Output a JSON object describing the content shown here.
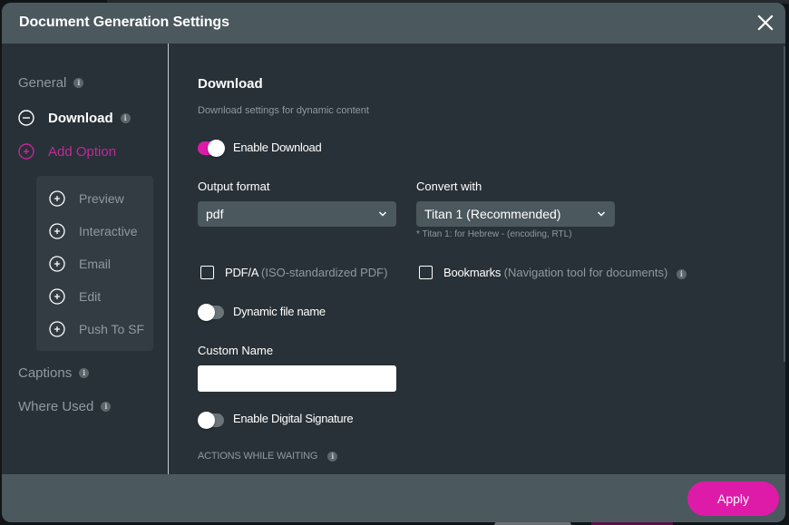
{
  "dialog": {
    "title": "Document Generation Settings",
    "close_icon": "close-icon"
  },
  "sidebar": {
    "items": [
      {
        "label": "General",
        "info": "i",
        "state": "default"
      },
      {
        "label": "Download",
        "info": "i",
        "state": "active",
        "icon": "minus-circle-icon"
      },
      {
        "label": "Add Option",
        "state": "add",
        "icon": "plus-circle-icon"
      }
    ],
    "add_options": [
      {
        "label": "Preview",
        "icon": "plus-circle-icon"
      },
      {
        "label": "Interactive",
        "icon": "plus-circle-icon"
      },
      {
        "label": "Email",
        "icon": "plus-circle-icon"
      },
      {
        "label": "Edit",
        "icon": "plus-circle-icon"
      },
      {
        "label": "Push To SF",
        "icon": "plus-circle-icon"
      }
    ],
    "bottom_items": [
      {
        "label": "Captions",
        "info": "i"
      },
      {
        "label": "Where Used",
        "info": "i"
      }
    ]
  },
  "content": {
    "title": "Download",
    "description": "Download settings for dynamic content",
    "enable_download": {
      "label": "Enable Download",
      "on": true
    },
    "output_format": {
      "label": "Output format",
      "value": "pdf"
    },
    "convert_with": {
      "label": "Convert with",
      "value": "Titan 1 (Recommended)",
      "hint": "* Titan 1: for Hebrew - (encoding, RTL)"
    },
    "pdfa": {
      "label": "PDF/A",
      "sublabel": "(ISO-standardized PDF)",
      "checked": false
    },
    "bookmarks": {
      "label": "Bookmarks",
      "sublabel": "(Navigation tool for documents)",
      "info": "i",
      "checked": false
    },
    "dynamic_file_name": {
      "label": "Dynamic file name",
      "on": false
    },
    "custom_name": {
      "label": "Custom Name",
      "value": "",
      "placeholder": ""
    },
    "digital_signature": {
      "label": "Enable Digital Signature",
      "on": false
    },
    "actions_while_waiting": {
      "label": "ACTIONS WHILE WAITING",
      "info": "i"
    }
  },
  "footer": {
    "apply_label": "Apply"
  },
  "colors": {
    "accent": "#dd1ba8",
    "header_bg": "#4b585e",
    "body_bg": "#283137",
    "muted_text": "#8f999e",
    "add_option_text": "#c2279b"
  }
}
